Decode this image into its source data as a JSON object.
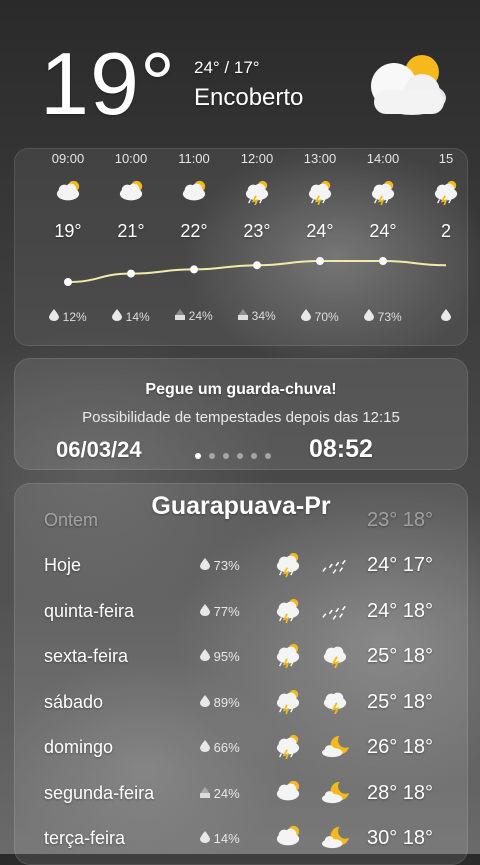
{
  "current": {
    "temp": "19°",
    "hilo": "24° / 17°",
    "condition": "Encoberto",
    "icon": "partly-cloudy-icon"
  },
  "hourly": [
    {
      "time": "09:00",
      "icon": "partly-cloudy-icon",
      "temp": "19°",
      "precip": "12%",
      "precip_icon": "drop-icon"
    },
    {
      "time": "10:00",
      "icon": "partly-cloudy-icon",
      "temp": "21°",
      "precip": "14%",
      "precip_icon": "drop-icon"
    },
    {
      "time": "11:00",
      "icon": "partly-cloudy-icon",
      "temp": "22°",
      "precip": "24%",
      "precip_icon": "half-drop-icon"
    },
    {
      "time": "12:00",
      "icon": "thunder-rain-icon",
      "temp": "23°",
      "precip": "34%",
      "precip_icon": "half-drop-icon"
    },
    {
      "time": "13:00",
      "icon": "thunder-rain-icon",
      "temp": "24°",
      "precip": "70%",
      "precip_icon": "drop-icon"
    },
    {
      "time": "14:00",
      "icon": "thunder-rain-icon",
      "temp": "24°",
      "precip": "73%",
      "precip_icon": "drop-icon"
    },
    {
      "time": "15",
      "icon": "thunder-rain-icon",
      "temp": "2",
      "precip": "",
      "precip_icon": "drop-icon"
    }
  ],
  "hourly_temps_numeric": [
    19,
    21,
    22,
    23,
    24,
    24,
    23
  ],
  "alert": {
    "title": "Pegue um guarda-chuva!",
    "subtitle": "Possibilidade de tempestades depois das 12:15",
    "date": "06/03/24",
    "time": "08:52",
    "page_count": 6,
    "active_page": 1
  },
  "forecast": {
    "city": "Guarapuava-Pr",
    "days": [
      {
        "day": "Ontem",
        "precip": "",
        "icon1": "",
        "icon2": "",
        "hilo": "23° 18°",
        "dim": true
      },
      {
        "day": "Hoje",
        "precip": "73%",
        "icon1": "thunder-rain-icon",
        "icon2": "rain-icon",
        "hilo": "24° 17°"
      },
      {
        "day": "quinta-feira",
        "precip": "77%",
        "icon1": "thunder-rain-icon",
        "icon2": "rain-icon",
        "hilo": "24° 18°"
      },
      {
        "day": "sexta-feira",
        "precip": "95%",
        "icon1": "thunder-rain-icon",
        "icon2": "night-thunder-icon",
        "hilo": "25° 18°"
      },
      {
        "day": "sábado",
        "precip": "89%",
        "icon1": "thunder-rain-icon",
        "icon2": "night-thunder-icon",
        "hilo": "25° 18°"
      },
      {
        "day": "domingo",
        "precip": "66%",
        "icon1": "thunder-rain-icon",
        "icon2": "moon-cloud-icon",
        "hilo": "26° 18°"
      },
      {
        "day": "segunda-feira",
        "precip": "24%",
        "icon1": "partly-cloudy-icon",
        "icon2": "moon-cloud-icon",
        "hilo": "28° 18°"
      },
      {
        "day": "terça-feira",
        "precip": "14%",
        "icon1": "partly-cloudy-icon",
        "icon2": "moon-cloud-icon",
        "hilo": "30° 18°"
      }
    ]
  },
  "colors": {
    "sun": "#f5b91e",
    "bolt": "#f5b91e",
    "cloud": "#f4f4f4",
    "curve": "#f3eaa8"
  }
}
